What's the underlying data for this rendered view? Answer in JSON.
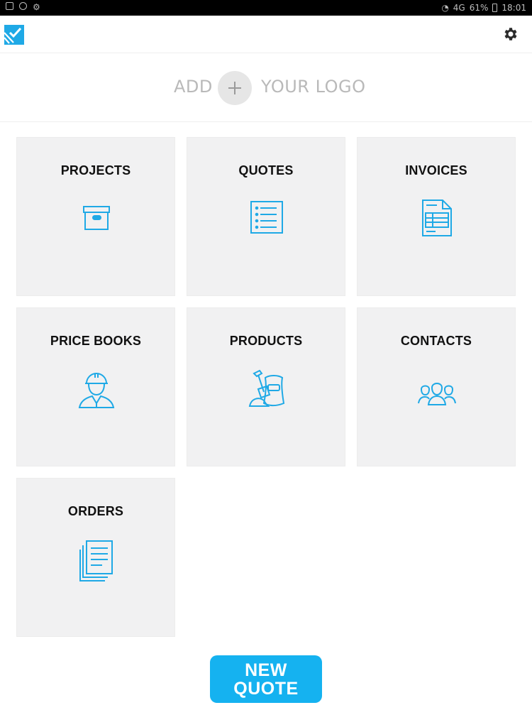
{
  "status_bar": {
    "signal": "4G",
    "battery_percent": "61%",
    "time": "18:01"
  },
  "logo_area": {
    "add_label": "ADD",
    "your_logo_label": "YOUR LOGO"
  },
  "tiles": [
    {
      "label": "PROJECTS",
      "icon": "archive-box-icon"
    },
    {
      "label": "QUOTES",
      "icon": "list-document-icon"
    },
    {
      "label": "INVOICES",
      "icon": "invoice-document-icon"
    },
    {
      "label": "PRICE BOOKS",
      "icon": "worker-helmet-icon"
    },
    {
      "label": "PRODUCTS",
      "icon": "shovel-sack-icon"
    },
    {
      "label": "CONTACTS",
      "icon": "people-group-icon"
    },
    {
      "label": "ORDERS",
      "icon": "stacked-documents-icon"
    }
  ],
  "new_quote": {
    "line1": "NEW",
    "line2": "QUOTE"
  },
  "colors": {
    "accent": "#15b2f0",
    "tile_bg": "#f1f1f2",
    "icon": "#1fa9e6"
  }
}
